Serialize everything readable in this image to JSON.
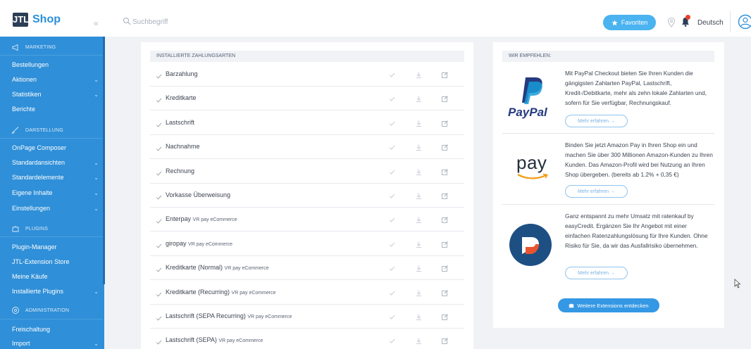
{
  "header": {
    "logo_box": "JTL",
    "logo_text": "Shop",
    "collapse": "«",
    "search_placeholder": "Suchbegriff",
    "favorites_label": "Favoriten",
    "language": "Deutsch"
  },
  "sidebar": {
    "marketing": "MARKETING",
    "bestellungen": "Bestellungen",
    "aktionen": "Aktionen",
    "statistiken": "Statistiken",
    "berichte": "Berichte",
    "darstellung": "DARSTELLUNG",
    "onpage": "OnPage Composer",
    "standardansichten": "Standardansichten",
    "standardelemente": "Standardelemente",
    "eigene_inhalte": "Eigene Inhalte",
    "einstellungen": "Einstellungen",
    "plugins": "PLUGINS",
    "plugin_manager": "Plugin-Manager",
    "extension_store": "JTL-Extension Store",
    "meine_kaeufe": "Meine Käufe",
    "installierte_plugins": "Installierte Plugins",
    "administration": "ADMINISTRATION",
    "freischaltung": "Freischaltung",
    "import": "Import"
  },
  "payments": {
    "heading": "INSTALLIERTE ZAHLUNGSARTEN",
    "rows": [
      {
        "name": "Barzahlung",
        "sub": ""
      },
      {
        "name": "Kreditkarte",
        "sub": ""
      },
      {
        "name": "Lastschrift",
        "sub": ""
      },
      {
        "name": "Nachnahme",
        "sub": ""
      },
      {
        "name": "Rechnung",
        "sub": ""
      },
      {
        "name": "Vorkasse Überweisung",
        "sub": ""
      },
      {
        "name": "Enterpay",
        "sub": "VR pay eCommerce"
      },
      {
        "name": "giropay",
        "sub": "VR pay eCommerce"
      },
      {
        "name": "Kreditkarte (Normal)",
        "sub": "VR pay eCommerce"
      },
      {
        "name": "Kreditkarte (Recurring)",
        "sub": "VR pay eCommerce"
      },
      {
        "name": "Lastschrift (SEPA Recurring)",
        "sub": "VR pay eCommerce"
      },
      {
        "name": "Lastschrift (SEPA)",
        "sub": "VR pay eCommerce"
      }
    ]
  },
  "recommend": {
    "heading": "WIR EMPFEHLEN:",
    "paypal_logo": "PayPal",
    "amazon_logo": "pay",
    "paypal_text": "Mit PayPal Checkout bieten Sie Ihren Kunden die gängigsten Zahlarten PayPal, Lastschrift, Kredit-/Debitkarte, mehr als zehn lokale Zahlarten und, sofern für Sie verfügbar, Rechnungskauf.",
    "amazon_text": "Binden Sie jetzt Amazon Pay in Ihren Shop ein und machen Sie über 300 Millionen Amazon-Kunden zu Ihren Kunden. Das Amazon-Profil wird bei Nutzung an Ihren Shop übergeben. (bereits ab 1.2% + 0,35 €)",
    "easycredit_text": "Ganz entspannt zu mehr Umsatz mit ratenkauf by easyCredit. Ergänzen Sie Ihr Angebot mit einer einfachen Ratenzahlungslösung für Ihre Kunden. Ohne Risiko für Sie, da wir das Ausfallrisiko übernehmen.",
    "more_label": "Mehr erfahren →",
    "extensions_label": "Weitere Extensions entdecken"
  },
  "colors": {
    "sidebar": "#2f8fd8",
    "accent": "#4ab3f0",
    "paypal_dark": "#253b80",
    "paypal_light": "#179bd7"
  }
}
